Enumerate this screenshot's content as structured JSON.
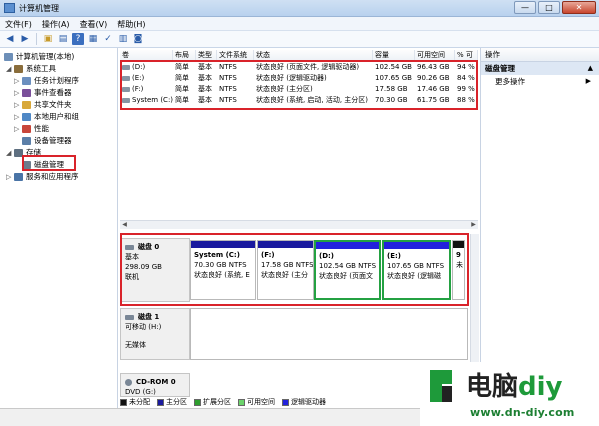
{
  "window": {
    "title": "计算机管理",
    "min": "—",
    "max": "□",
    "close": "✕"
  },
  "menu": [
    "文件(F)",
    "操作(A)",
    "查看(V)",
    "帮助(H)"
  ],
  "tree": {
    "root": "计算机管理(本地)",
    "items": [
      {
        "label": "系统工具",
        "level": 1,
        "exp": "◢",
        "icon_color": "#8a6d3b"
      },
      {
        "label": "任务计划程序",
        "level": 2,
        "exp": "▷",
        "icon_color": "#6b8fbf"
      },
      {
        "label": "事件查看器",
        "level": 2,
        "exp": "▷",
        "icon_color": "#7a4f9a"
      },
      {
        "label": "共享文件夹",
        "level": 2,
        "exp": "▷",
        "icon_color": "#d8a83a"
      },
      {
        "label": "本地用户和组",
        "level": 2,
        "exp": "▷",
        "icon_color": "#4f88c6"
      },
      {
        "label": "性能",
        "level": 2,
        "exp": "▷",
        "icon_color": "#c8463a"
      },
      {
        "label": "设备管理器",
        "level": 2,
        "exp": "",
        "icon_color": "#5b7fa8"
      },
      {
        "label": "存储",
        "level": 1,
        "exp": "◢",
        "icon_color": "#5e6f80"
      },
      {
        "label": "磁盘管理",
        "level": 2,
        "exp": "",
        "icon_color": "#6c7c8c"
      },
      {
        "label": "服务和应用程序",
        "level": 1,
        "exp": "▷",
        "icon_color": "#4a74a6"
      }
    ]
  },
  "volume_table": {
    "columns": [
      "卷",
      "布局",
      "类型",
      "文件系统",
      "状态",
      "容量",
      "可用空间",
      "% 可"
    ],
    "rows": [
      [
        "(D:)",
        "简单",
        "基本",
        "NTFS",
        "状态良好 (页面文件, 逻辑驱动器)",
        "102.54 GB",
        "96.43 GB",
        "94 %"
      ],
      [
        "(E:)",
        "简单",
        "基本",
        "NTFS",
        "状态良好 (逻辑驱动器)",
        "107.65 GB",
        "90.26 GB",
        "84 %"
      ],
      [
        "(F:)",
        "简单",
        "基本",
        "NTFS",
        "状态良好 (主分区)",
        "17.58 GB",
        "17.46 GB",
        "99 %"
      ],
      [
        "System (C:)",
        "简单",
        "基本",
        "NTFS",
        "状态良好 (系统, 启动, 活动, 主分区)",
        "70.30 GB",
        "61.75 GB",
        "88 %"
      ]
    ]
  },
  "disks": [
    {
      "title": "磁盘 0",
      "type": "基本",
      "size": "298.09 GB",
      "state": "联机",
      "partitions": [
        {
          "name": "System (C:)",
          "size": "70.30 GB NTFS",
          "status": "状态良好 (系统, E",
          "bar": "#1a1a9e"
        },
        {
          "name": "(F:)",
          "size": "17.58 GB NTFS",
          "status": "状态良好 (主分",
          "bar": "#1a1a9e"
        },
        {
          "name": "(D:)",
          "size": "102.54 GB NTFS",
          "status": "状态良好 (页面文",
          "bar": "#2222dd"
        },
        {
          "name": "(E:)",
          "size": "107.65 GB NTFS",
          "status": "状态良好 (逻辑磁",
          "bar": "#2222dd"
        },
        {
          "name": "9",
          "size": "未",
          "status": "",
          "bar": "#111111"
        }
      ]
    },
    {
      "title": "磁盘 1",
      "type": "可移动 (H:)",
      "size": "",
      "state": "无媒体"
    },
    {
      "title": "CD-ROM 0",
      "type": "DVD (G:)",
      "size": "",
      "state": ""
    }
  ],
  "legend": [
    {
      "label": "未分配",
      "color": "#111111"
    },
    {
      "label": "主分区",
      "color": "#1a1a9e"
    },
    {
      "label": "扩展分区",
      "color": "#2e9e2e"
    },
    {
      "label": "可用空间",
      "color": "#6bd36b"
    },
    {
      "label": "逻辑驱动器",
      "color": "#2222dd"
    }
  ],
  "actions": {
    "header": "操作",
    "section": "磁盘管理",
    "more": "更多操作"
  },
  "watermark": {
    "cn_a": "电脑",
    "cn_b": "diy",
    "url": "www.dn-diy.com"
  }
}
